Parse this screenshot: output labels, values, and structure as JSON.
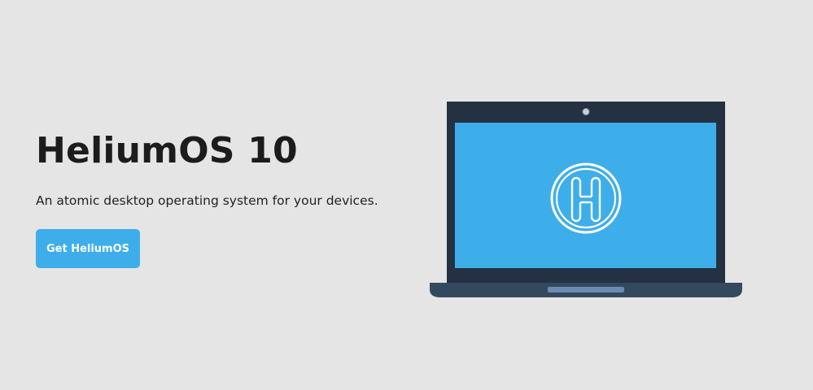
{
  "hero": {
    "title": "HeliumOS 10",
    "tagline": "An atomic desktop operating system for your devices.",
    "cta_label": "Get HeliumOS"
  },
  "illustration": {
    "subject": "laptop",
    "logo_icon": "heliumos-logo-icon",
    "logo_letter": "H"
  },
  "colors": {
    "background": "#e5e5e5",
    "accent": "#3daee9",
    "laptop_frame": "#233142",
    "laptop_base": "#34495e",
    "screen": "#3daee9",
    "title_text": "#1c1c1c"
  }
}
